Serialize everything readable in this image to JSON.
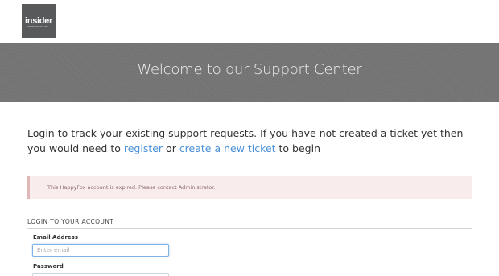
{
  "brand": {
    "logo_text": "insider",
    "logo_subtext": "MARKETING, INC.",
    "logo_bg": "#58595b"
  },
  "banner": {
    "title": "Welcome to our Support Center",
    "bg": "#737373"
  },
  "intro": {
    "text_before": "Login to track your existing support requests. If you have not created a ticket yet then you would need to ",
    "register_link": "register",
    "text_or": " or ",
    "new_ticket_link": "create a new ticket",
    "text_after": " to begin",
    "link_color": "#4a90d9"
  },
  "alert": {
    "message": "This HappyFox account is expired. Please contact Administrator.",
    "bg": "#f9ecec"
  },
  "login": {
    "heading": "LOGIN TO YOUR ACCOUNT",
    "email_label": "Email Address",
    "email_placeholder": "Enter email",
    "email_value": "",
    "password_label": "Password",
    "password_value": ""
  }
}
